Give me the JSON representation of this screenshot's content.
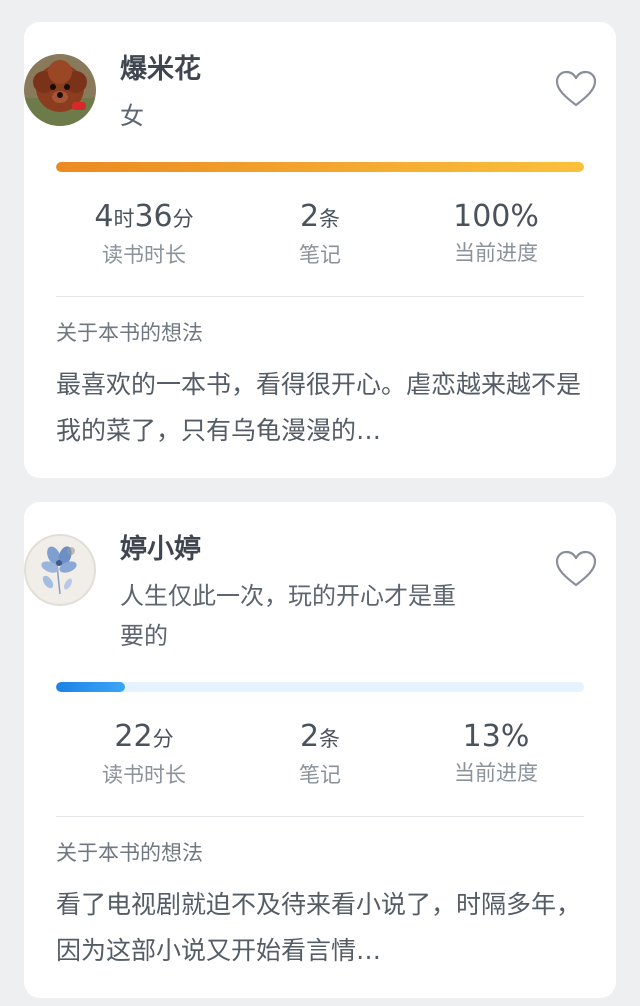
{
  "stat_labels": {
    "time": "读书时长",
    "notes": "笔记",
    "progress": "当前进度"
  },
  "thought_title": "关于本书的想法",
  "reviews": [
    {
      "name": "爆米花",
      "subtitle": "女",
      "avatar": "dog-avatar",
      "liked": false,
      "progress_fraction": 1.0,
      "time": {
        "h": "4",
        "h_unit": "时",
        "m": "36",
        "m_unit": "分"
      },
      "notes": {
        "value": "2",
        "unit": "条"
      },
      "progress_text": "100%",
      "thought": "最喜欢的一本书，看得很开心。虐恋越来越不是我的菜了，只有乌龟漫漫的…"
    },
    {
      "name": "婷小婷",
      "subtitle": "人生仅此一次，玩的开心才是重要的",
      "avatar": "flower-avatar",
      "liked": false,
      "progress_fraction": 0.13,
      "time": {
        "m": "22",
        "m_unit": "分"
      },
      "notes": {
        "value": "2",
        "unit": "条"
      },
      "progress_text": "13%",
      "thought": "看了电视剧就迫不及待来看小说了，时隔多年，因为这部小说又开始看言情…"
    }
  ],
  "colors": {
    "page_bg": "#eeeff1",
    "bar_orange": "#eb8a21",
    "bar_blue": "#1d82e5"
  }
}
